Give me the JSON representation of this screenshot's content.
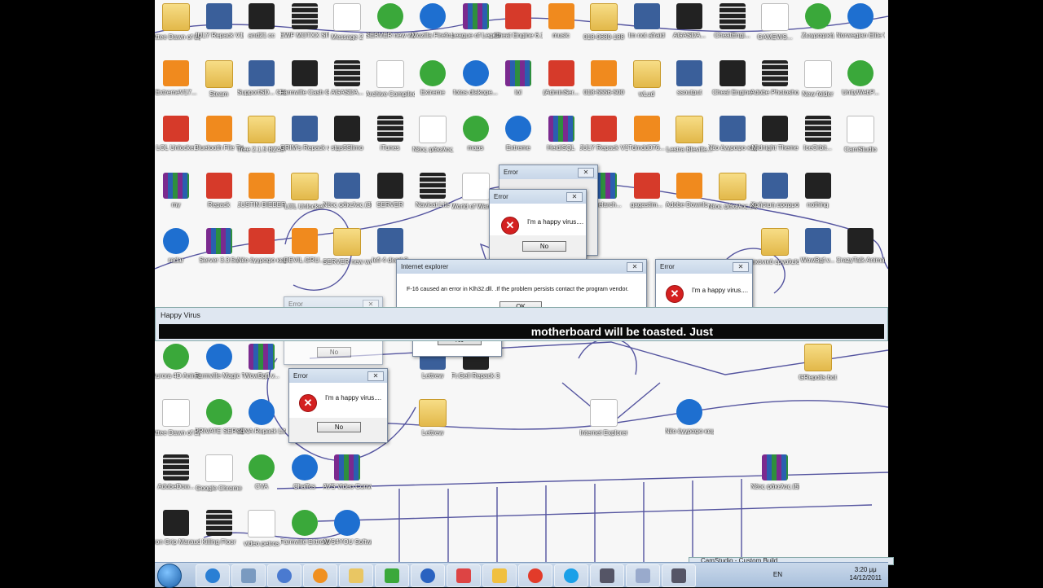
{
  "desktop": {
    "rows": [
      [
        "Attee Dawn of Light 4.3.2",
        "JULY Repack V12",
        "and21 cc",
        "EWF MOTXX SITE",
        "Message 2",
        "SERVER new work 2011",
        "Mozilla Firefox",
        "League of Legends ...",
        "Cheat Engine 6.1 (32 bit)",
        "music",
        "018-0680-188",
        "Im not afraid",
        "AGASDA...",
        "CheatEngi...",
        "GAMEWS...",
        "Ζωγραφική",
        "Norwegian Elite World"
      ],
      [
        "ExtremeV17...",
        "Steam",
        "SupportSD... Guide",
        "Farmville Cash Ge...",
        "AGASDA...",
        "Archive Compiled ...",
        "Extreme",
        "fotos diakope...",
        "lol",
        "(AdminSer...",
        "018-5556-500",
        "wLud",
        "ssoutput",
        "Cheat Engine",
        "Adobe Photosho...",
        "New folder",
        "UnityWebP..."
      ],
      [
        "LOL Unlocker",
        "Bluetooth File Transf...",
        "Tree 2.1.5 BZ40 Stable",
        "GRIM's Repack v3",
        "stgs5Slimo",
        "iTunes",
        "Νέος φάκελος",
        "maps",
        "Extreme",
        "HeidiSQL",
        "JULY Repack V12",
        "Tdmdd076...",
        "Lestra Bleville...",
        "Νέο έγγραφο κειμένου",
        "Midnight Theme",
        "IceOrbit...",
        "CamStudio"
      ],
      [
        "my",
        "Repack",
        "JUSTIN BIEBER",
        "LOL Unlocker",
        "Νέος φάκελος (3)",
        "SERVER",
        "Navicat Lite",
        "World of Warcraft",
        "",
        "zamkí skládaní",
        "komelarch...",
        "gagastim...",
        "Adobe Downlo...",
        "Νέος φάκελος (4)",
        "Χρήσιμη εφαρμογή...",
        "nothing"
      ],
      [
        "radar",
        "Server 3.3.5a",
        "Νέο έγγραφο κειμένου (3)",
        "DEVIL.GRU...",
        "SERVER new work 2011",
        "lefi 4 dead 2",
        "",
        "",
        "",
        "",
        "",
        "",
        "",
        "",
        "εικονικό εργαλείο...",
        "WowBgf.v...",
        "CrazyTalk Animat..."
      ],
      [
        "Aurora 4D Animati...",
        "Farmville Magic Tools",
        "WowBgfl.v...",
        "",
        "",
        "",
        "Lettrew",
        "Fr.Gell Repack 3.3...",
        "",
        "",
        "",
        "",
        "",
        "",
        "",
        "GRepolis bot"
      ],
      [
        "Attee Dawn of Light 4.3.2",
        "PRIVATE SERVER",
        "sdNA Repack Lite",
        "",
        "",
        "",
        "Lettrew",
        "",
        "",
        "",
        "Internet Explorer",
        "",
        "Νέο έγγραφο κειμένου (2)"
      ],
      [
        "AdobeDow...",
        "Google Chrome",
        "CVA",
        "Chaffcs",
        "AVS Video Converter",
        "",
        "",
        "",
        "",
        "",
        "",
        "",
        "",
        "",
        "Νέος φάκελος (5)"
      ],
      [
        "Iron Grip Marauders",
        "Killing Floor",
        "video petros",
        "Farmville Extreme ...",
        "AVS4YOU Softwar..."
      ]
    ]
  },
  "dialogs": {
    "error_title": "Error",
    "happy_msg": "I'm a happy virus....",
    "no_label": "No",
    "ie_title": "Internet explorer",
    "ie_msg": "F-16 caused an error in Klh32.dll. .If the problem persists contact the program vendor.",
    "ok_label": "OK",
    "close_glyph": "✕"
  },
  "happy_virus": {
    "title": "Happy Virus",
    "banner": "motherboard will be toasted. Just"
  },
  "taskbar": {
    "camstudio_title": "CamStudio - Custom Build",
    "lang": "EN",
    "time": "3:20 μμ",
    "date": "14/12/2011"
  },
  "colors": {
    "error_red": "#d42020",
    "banner_black": "#0a0a0a",
    "taskbar": "#b8cce4"
  }
}
